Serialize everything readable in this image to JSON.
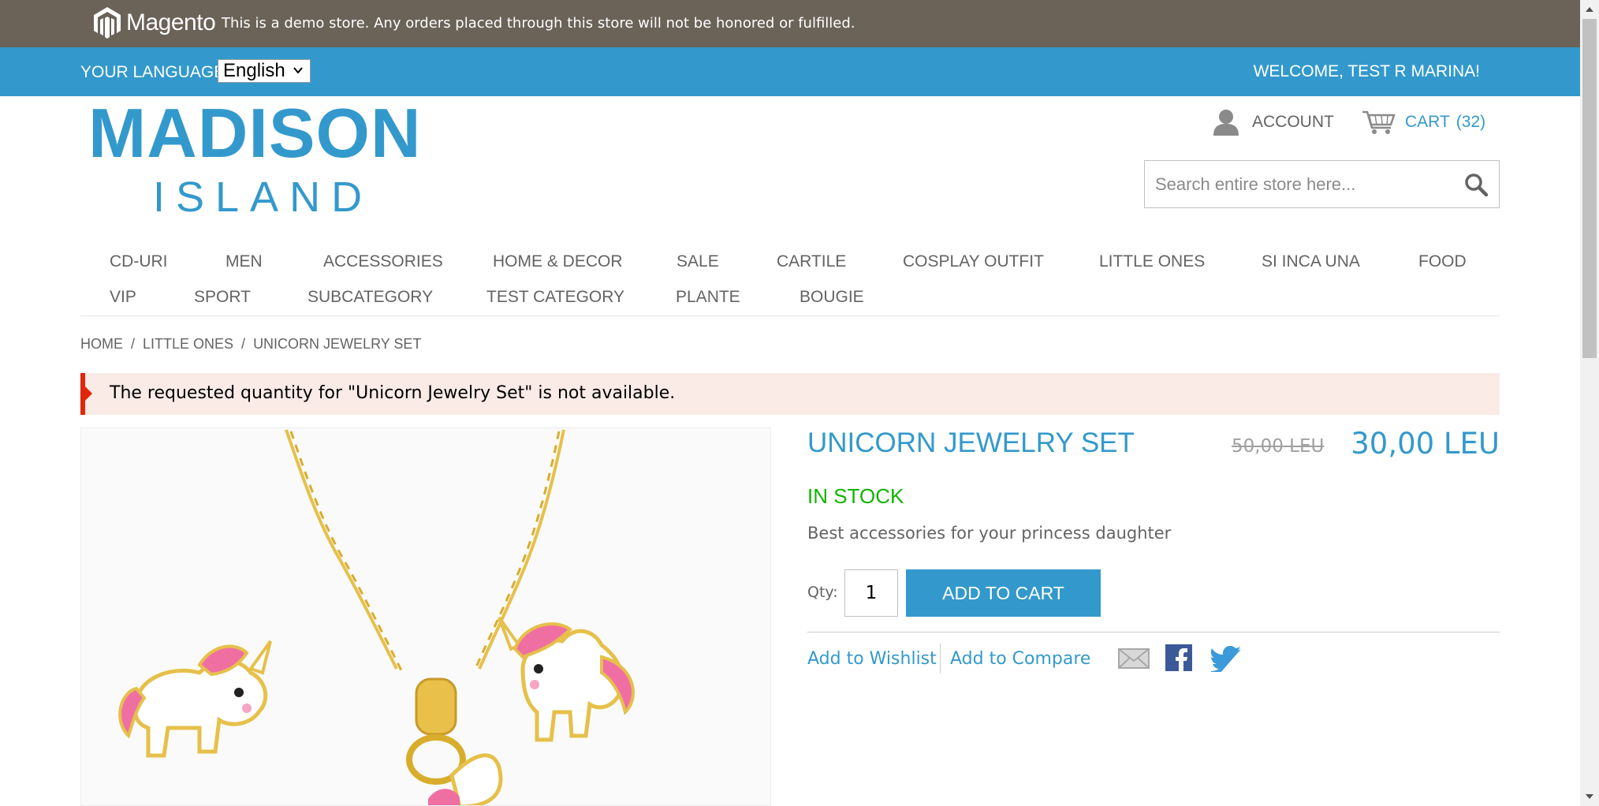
{
  "demo_notice": {
    "logo_text": "Magento",
    "text": "This is a demo store. Any orders placed through this store will not be honored or fulfilled."
  },
  "language_bar": {
    "label": "YOUR LANGUAGE:",
    "selected_language": "English",
    "welcome": "WELCOME, TEST R MARINA!"
  },
  "header": {
    "logo_line1": "MADISON",
    "logo_line2": "ISLAND",
    "account_label": "ACCOUNT",
    "cart_label": "CART",
    "cart_count": "(32)",
    "search_placeholder": "Search entire store here..."
  },
  "nav": {
    "row1": [
      "CD-URI",
      "MEN",
      "ACCESSORIES",
      "HOME & DECOR",
      "SALE",
      "CARTILE",
      "COSPLAY OUTFIT",
      "LITTLE ONES",
      "SI INCA UNA",
      "FOOD"
    ],
    "row2": [
      "VIP",
      "SPORT",
      "SUBCATEGORY",
      "TEST CATEGORY",
      "PLANTE",
      "BOUGIE"
    ]
  },
  "breadcrumb": {
    "items": [
      "HOME",
      "LITTLE ONES",
      "UNICORN JEWELRY SET"
    ],
    "separator": "/"
  },
  "message": {
    "error": "The requested quantity for \"Unicorn Jewelry Set\" is not available."
  },
  "product": {
    "name": "UNICORN JEWELRY SET",
    "old_price": "50,00 LEU",
    "special_price": "30,00 LEU",
    "availability": "IN STOCK",
    "short_description": "Best accessories for your princess daughter",
    "qty_label": "Qty:",
    "qty_value": "1",
    "add_to_cart_label": "ADD TO CART",
    "wishlist_label": "Add to Wishlist",
    "compare_label": "Add to Compare",
    "share_icons": [
      "email-icon",
      "facebook-icon",
      "twitter-icon"
    ]
  },
  "colors": {
    "demo_bar": "#6b6258",
    "brand_blue": "#3399cc",
    "error_bg": "#faebe7",
    "error_accent": "#df280a",
    "in_stock": "#11b400"
  }
}
